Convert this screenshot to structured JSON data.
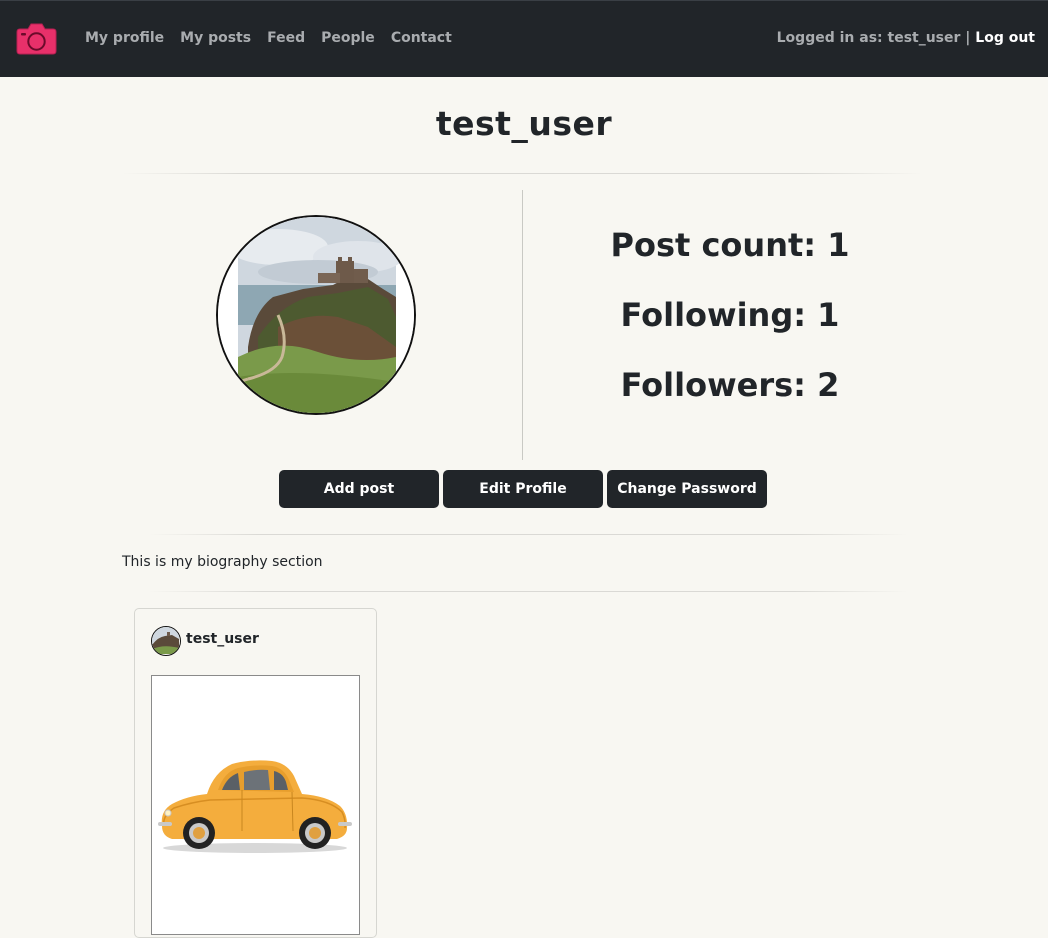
{
  "nav": {
    "links": [
      "My profile",
      "My posts",
      "Feed",
      "People",
      "Contact"
    ],
    "logged_in_text": "Logged in as: test_user | ",
    "logout_label": "Log out"
  },
  "profile": {
    "username": "test_user",
    "post_count": "Post count: 1",
    "following": "Following: 1",
    "followers": "Followers: 2",
    "bio": "This is my biography section"
  },
  "actions": {
    "add_post": "Add post",
    "edit_profile": "Edit Profile",
    "change_password": "Change Password"
  },
  "posts": [
    {
      "author": "test_user"
    }
  ],
  "colors": {
    "navbar": "#212529",
    "logo": "#e8306a",
    "background": "#f8f7f2",
    "button": "#212529"
  },
  "icons": {
    "logo": "camera-icon"
  }
}
